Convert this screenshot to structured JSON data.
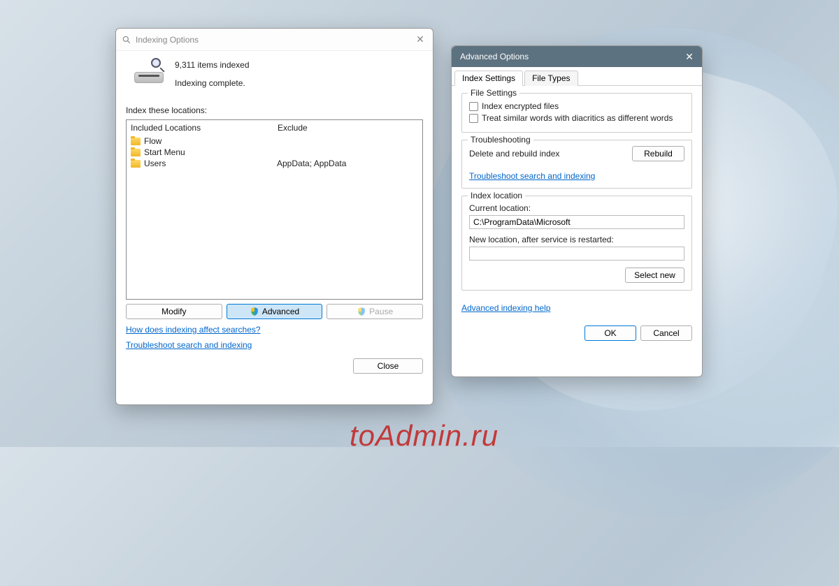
{
  "watermark": "toAdmin.ru",
  "window1": {
    "title": "Indexing Options",
    "items_indexed": "9,311 items indexed",
    "status": "Indexing complete.",
    "locations_label": "Index these locations:",
    "columns": {
      "included": "Included Locations",
      "exclude": "Exclude"
    },
    "rows": [
      {
        "name": "Flow",
        "exclude": ""
      },
      {
        "name": "Start Menu",
        "exclude": ""
      },
      {
        "name": "Users",
        "exclude": "AppData; AppData"
      }
    ],
    "buttons": {
      "modify": "Modify",
      "advanced": "Advanced",
      "pause": "Pause",
      "close": "Close"
    },
    "links": {
      "help": "How does indexing affect searches?",
      "troubleshoot": "Troubleshoot search and indexing"
    }
  },
  "window2": {
    "title": "Advanced Options",
    "tabs": {
      "index_settings": "Index Settings",
      "file_types": "File Types"
    },
    "file_settings": {
      "legend": "File Settings",
      "encrypted": "Index encrypted files",
      "diacritics": "Treat similar words with diacritics as different words"
    },
    "troubleshooting": {
      "legend": "Troubleshooting",
      "rebuild_label": "Delete and rebuild index",
      "rebuild_btn": "Rebuild",
      "link": "Troubleshoot search and indexing"
    },
    "index_location": {
      "legend": "Index location",
      "current_label": "Current location:",
      "current_value": "C:\\ProgramData\\Microsoft",
      "new_label": "New location, after service is restarted:",
      "new_value": "",
      "select_new": "Select new"
    },
    "help_link": "Advanced indexing help",
    "buttons": {
      "ok": "OK",
      "cancel": "Cancel"
    }
  }
}
